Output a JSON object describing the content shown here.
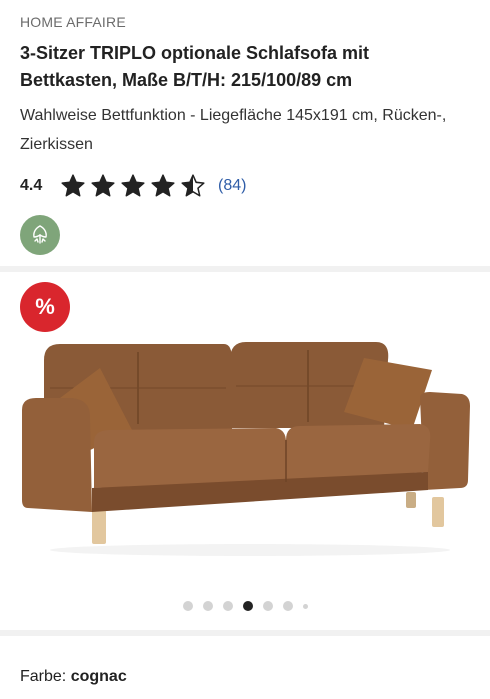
{
  "product": {
    "brand": "HOME AFFAIRE",
    "title": "3-Sitzer TRIPLO optionale Schlafsofa mit Bettkasten, Maße B/T/H: 215/100/89 cm",
    "subtitle": "Wahlweise Bettfunktion - Liegefläche 145x191 cm, Rücken-, Zierkissen"
  },
  "rating": {
    "value": "4.4",
    "stars": 4.5,
    "max_stars": 5,
    "review_count": "(84)",
    "star_color": "#222222"
  },
  "badges": {
    "eco_icon": "leaf-recycle-icon",
    "eco_color": "#7fa57a",
    "sale_label": "%",
    "sale_color": "#d9262d"
  },
  "gallery": {
    "image_subject": "sofa-image",
    "dot_count": 7,
    "active_index": 3
  },
  "variant": {
    "label": "Farbe:",
    "value": "cognac"
  }
}
